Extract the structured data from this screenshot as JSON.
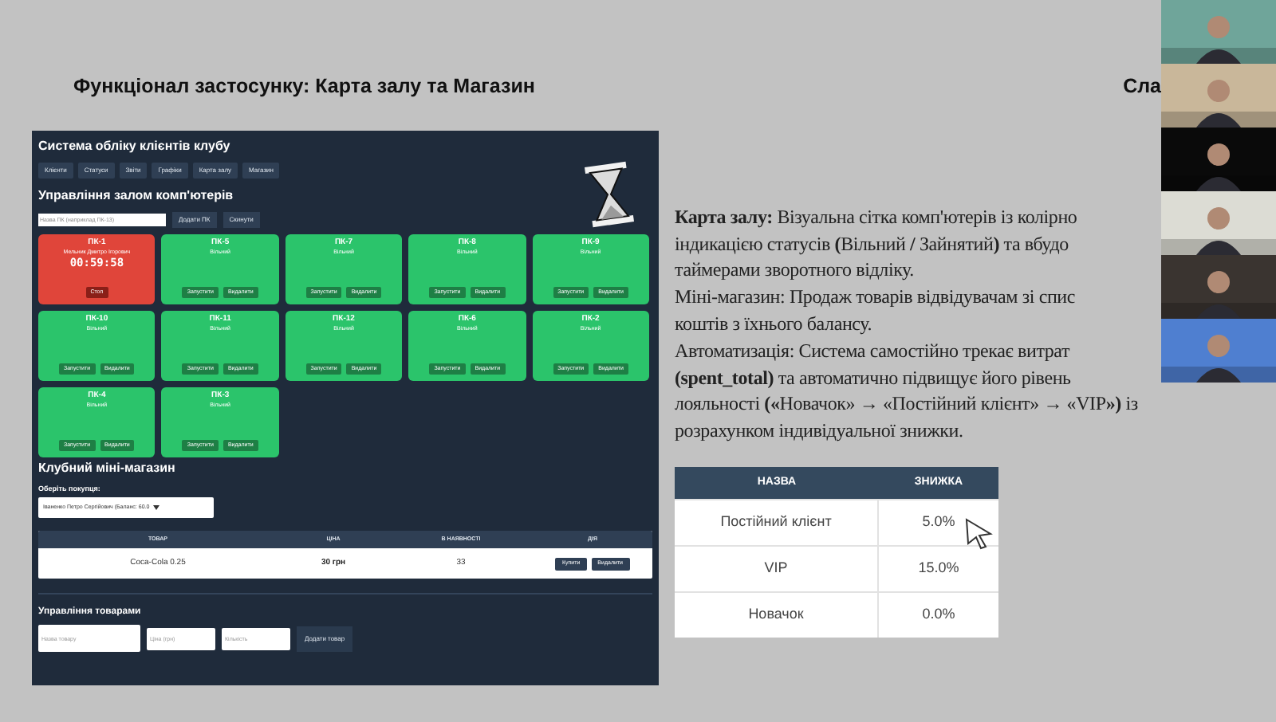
{
  "slide": {
    "title": "Функціонал застосунку: Карта залу та Магазин",
    "title_cut": "Сла",
    "app": {
      "title": "Система обліку клієнтів клубу",
      "nav": [
        "Клієнти",
        "Статуси",
        "Звіти",
        "Графіки",
        "Карта залу",
        "Магазин"
      ],
      "hall_heading": "Управління залом комп'ютерів",
      "pc_placeholder": "Назва ПК (наприклад ПК-13)",
      "add_pc": "Додати ПК",
      "reset": "Скинути",
      "pcs": [
        {
          "kind": "occupied",
          "name": "ПК-1",
          "client": "Мельник Дмитро Ігорович",
          "timer": "00:59:58",
          "actions": [
            "Стоп"
          ]
        },
        {
          "kind": "free",
          "name": "ПК-5",
          "status": "Вільний",
          "actions": [
            "Запустити",
            "Видалити"
          ]
        },
        {
          "kind": "free",
          "name": "ПК-7",
          "status": "Вільний",
          "actions": [
            "Запустити",
            "Видалити"
          ]
        },
        {
          "kind": "free",
          "name": "ПК-8",
          "status": "Вільний",
          "actions": [
            "Запустити",
            "Видалити"
          ]
        },
        {
          "kind": "free",
          "name": "ПК-9",
          "status": "Вільний",
          "actions": [
            "Запустити",
            "Видалити"
          ]
        },
        {
          "kind": "free",
          "name": "ПК-10",
          "status": "Вільний",
          "actions": [
            "Запустити",
            "Видалити"
          ]
        },
        {
          "kind": "free",
          "name": "ПК-11",
          "status": "Вільний",
          "actions": [
            "Запустити",
            "Видалити"
          ]
        },
        {
          "kind": "free",
          "name": "ПК-12",
          "status": "Вільний",
          "actions": [
            "Запустити",
            "Видалити"
          ]
        },
        {
          "kind": "free",
          "name": "ПК-6",
          "status": "Вільний",
          "actions": [
            "Запустити",
            "Видалити"
          ]
        },
        {
          "kind": "free",
          "name": "ПК-2",
          "status": "Вільний",
          "actions": [
            "Запустити",
            "Видалити"
          ]
        },
        {
          "kind": "free",
          "name": "ПК-4",
          "status": "Вільний",
          "actions": [
            "Запустити",
            "Видалити"
          ]
        },
        {
          "kind": "free",
          "name": "ПК-3",
          "status": "Вільний",
          "actions": [
            "Запустити",
            "Видалити"
          ]
        }
      ],
      "shop_heading": "Клубний міні-магазин",
      "buyer_label": "Оберіть покупця:",
      "buyer_value": "Іваненко Петро Сергійович (Баланс: 60.0",
      "products": {
        "columns": [
          "ТОВАР",
          "ЦІНА",
          "В НАЯВНОСТІ",
          "ДІЯ"
        ],
        "rows": [
          {
            "name": "Coca-Cola 0.25",
            "price": "30 грн",
            "stock": "33",
            "actions": [
              "Купити",
              "Видалити"
            ]
          }
        ]
      },
      "manage_heading": "Управління товарами",
      "product_placeholders": [
        "Назва товару",
        "Ціна (грн)",
        "Кількість"
      ],
      "add_product": "Додати товар"
    },
    "text_lines": [
      "**Карта залу:** Візуальна сітка комп'ютерів із колірно",
      "індикацією статусів **(**Вільний **/** Зайнятий**)** та вбудо",
      "таймерами зворотного відліку.",
      "Міні-магазин: Продаж товарів відвідувачам зі спис",
      "коштів з їхнього балансу.",
      "Автоматизація: Система самостійно трекає витрат",
      "**(spent_total)** та автоматично підвищує його рівень",
      "лояльності **(«**Новачок» → «Постійний клієнт» → «VIP**»)** із",
      "розрахунком індивідуальної знижки."
    ],
    "discounts": {
      "columns": [
        "НАЗВА",
        "ЗНИЖКА"
      ],
      "rows": [
        {
          "name": "Постійний клієнт",
          "value": "5.0%"
        },
        {
          "name": "VIP",
          "value": "15.0%"
        },
        {
          "name": "Новачок",
          "value": "0.0%"
        }
      ]
    }
  }
}
